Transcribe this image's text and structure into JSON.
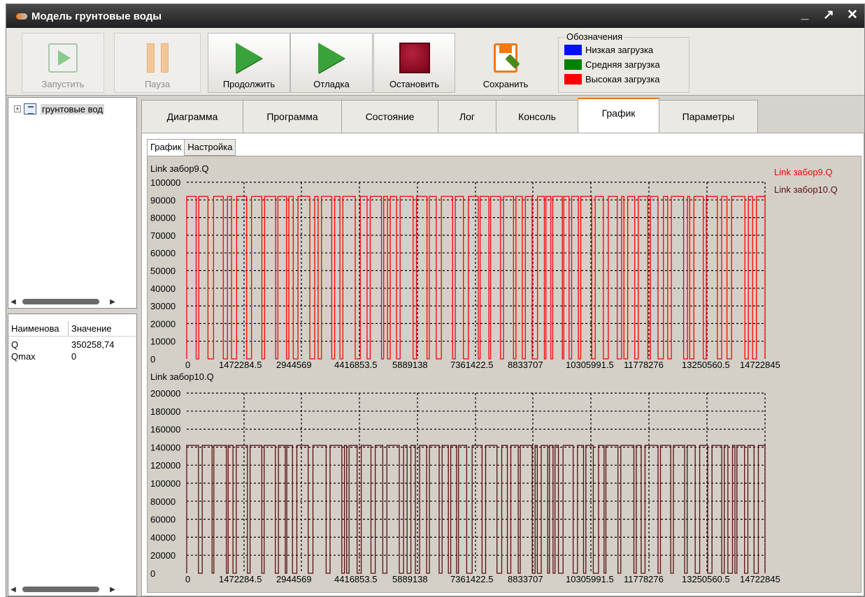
{
  "window": {
    "title": "Модель грунтовые воды",
    "min_glyph": "_",
    "max_glyph": "↗",
    "close_glyph": "✕"
  },
  "toolbar": {
    "run_label": "Запустить",
    "pause_label": "Пауза",
    "continue_label": "Продолжить",
    "debug_label": "Отладка",
    "stop_label": "Остановить",
    "save_label": "Сохранить"
  },
  "legend": {
    "title": "Обозначения",
    "items": [
      {
        "label": "Низкая загрузка",
        "color": "#0010ff"
      },
      {
        "label": "Средняя загрузка",
        "color": "#008000"
      },
      {
        "label": "Высокая загрузка",
        "color": "#ff0000"
      }
    ]
  },
  "tree": {
    "expander": "+",
    "root_label": "грунтовые вод"
  },
  "properties": {
    "col_name": "Наименова",
    "col_value": "Значение",
    "rows": [
      {
        "name": "Q",
        "value": "350258,74"
      },
      {
        "name": "Qmax",
        "value": "0"
      }
    ]
  },
  "tabs": [
    "Диаграмма",
    "Программа",
    "Состояние",
    "Лог",
    "Консоль",
    "График",
    "Параметры"
  ],
  "active_tab": "График",
  "subtabs": [
    "График",
    "Настройка"
  ],
  "chart_data": [
    {
      "type": "line",
      "title": "Link забор9.Q",
      "series": [
        {
          "name": "Link забор9.Q",
          "color": "#ff0000",
          "values_description_low": 0,
          "values_high": 92000
        }
      ],
      "x_tick_labels": [
        "0",
        "1472284.5",
        "2944569",
        "4416853.5",
        "5889138",
        "7361422.5",
        "8833707",
        "10305991.5",
        "11778276",
        "13250560.5",
        "14722845"
      ],
      "y_tick_labels": [
        "0",
        "10000",
        "20000",
        "30000",
        "40000",
        "50000",
        "60000",
        "70000",
        "80000",
        "90000",
        "100000"
      ],
      "xlim": [
        0,
        14722845
      ],
      "ylim": [
        0,
        100000
      ],
      "grid": true,
      "legend_position": "top-right"
    },
    {
      "type": "line",
      "title": "Link забор10.Q",
      "series": [
        {
          "name": "Link забор10.Q",
          "color": "#5a1010",
          "values_description_low": 0,
          "values_high": 142000
        }
      ],
      "x_tick_labels": [
        "0",
        "1472284.5",
        "2944569",
        "4416853.5",
        "5889138",
        "7361422.5",
        "8833707",
        "10305991.5",
        "11778276",
        "13250560.5",
        "14722845"
      ],
      "y_tick_labels": [
        "0",
        "20000",
        "40000",
        "60000",
        "80000",
        "100000",
        "120000",
        "140000",
        "160000",
        "180000",
        "200000"
      ],
      "xlim": [
        0,
        14722845
      ],
      "ylim": [
        0,
        200000
      ],
      "grid": true
    }
  ]
}
